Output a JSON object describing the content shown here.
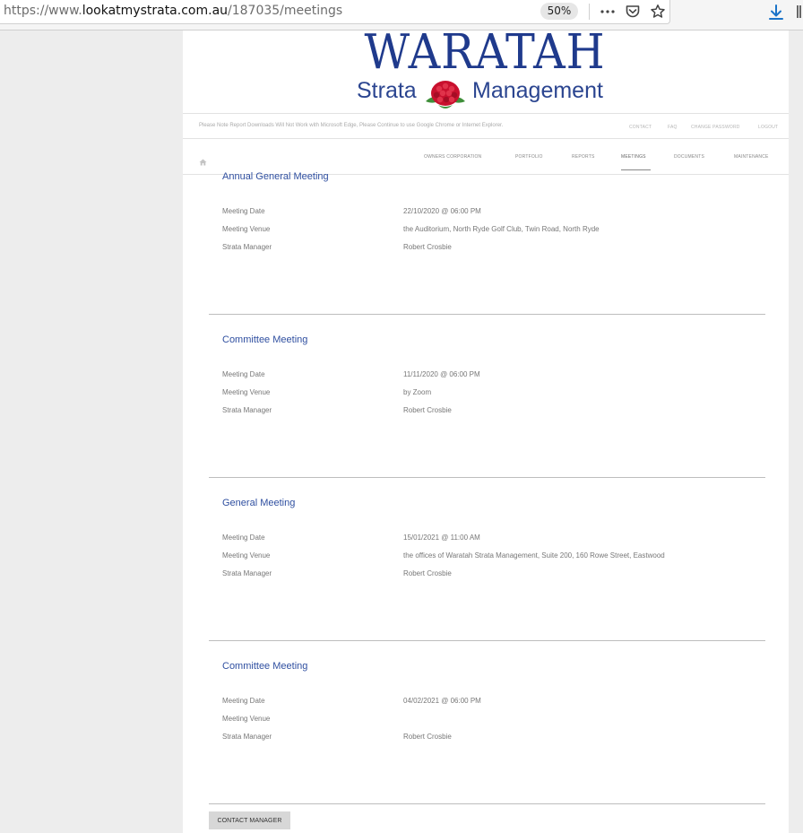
{
  "browser": {
    "url_prefix": "https://www.",
    "url_host": "lookatmystrata.com.au",
    "url_path": "/187035/meetings",
    "zoom": "50%"
  },
  "logo": {
    "title": "WARATAH",
    "word1": "Strata",
    "word2": "Management"
  },
  "notice": "Please Note Report Downloads Will Not Work with Microsoft Edge, Please Continue to use Google Chrome or Internet Explorer.",
  "top_links": {
    "contact": "CONTACT",
    "faq": "FAQ",
    "change_password": "CHANGE PASSWORD",
    "logout": "LOGOUT"
  },
  "nav": {
    "owners_corporation": "OWNERS CORPORATION",
    "portfolio": "PORTFOLIO",
    "reports": "REPORTS",
    "meetings": "MEETINGS",
    "documents": "DOCUMENTS",
    "maintenance": "MAINTENANCE",
    "active": "meetings"
  },
  "labels": {
    "date": "Meeting Date",
    "venue": "Meeting Venue",
    "manager": "Strata Manager"
  },
  "meetings": [
    {
      "title": "Annual General Meeting",
      "date": "22/10/2020 @ 06:00 PM",
      "venue": "the Auditorium, North Ryde Golf Club, Twin Road, North Ryde",
      "manager": "Robert Crosbie"
    },
    {
      "title": "Committee Meeting",
      "date": "11/11/2020 @ 06:00 PM",
      "venue": "by Zoom",
      "manager": "Robert Crosbie"
    },
    {
      "title": "General Meeting",
      "date": "15/01/2021 @ 11:00 AM",
      "venue": "the offices of Waratah Strata Management, Suite 200, 160 Rowe Street, Eastwood",
      "manager": "Robert Crosbie"
    },
    {
      "title": "Committee Meeting",
      "date": "04/02/2021 @ 06:00 PM",
      "venue": "",
      "manager": "Robert Crosbie"
    }
  ],
  "contact_button": "CONTACT MANAGER",
  "colors": {
    "link_blue": "#2f4fa0",
    "logo_blue": "#1f3a8c",
    "flower_red": "#c8102e"
  }
}
